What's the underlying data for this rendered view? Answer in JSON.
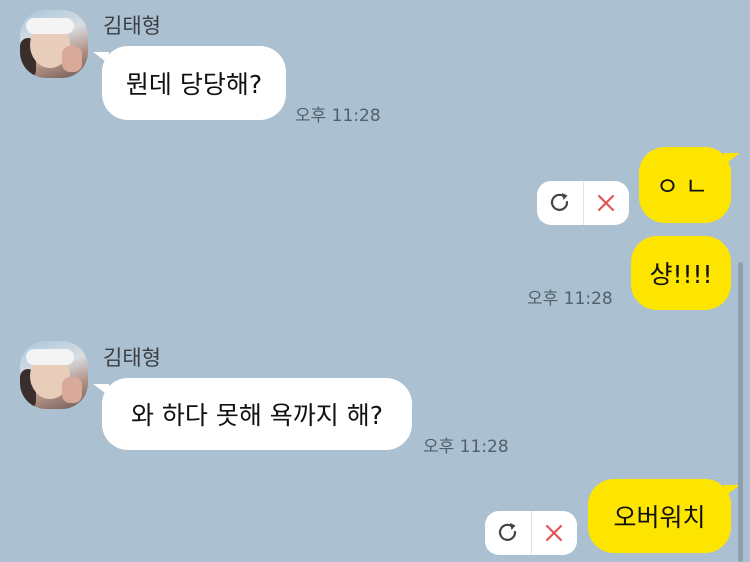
{
  "messages": {
    "m1": {
      "sender": "김태형",
      "text": "뭔데 당당해?",
      "time": "오후 11:28"
    },
    "m2": {
      "text": "ㅇㄴ"
    },
    "m3": {
      "text": "샹!!!!",
      "time": "오후 11:28"
    },
    "m4": {
      "sender": "김태형",
      "text": "와 하다 못해 욕까지 해?",
      "time": "오후 11:28"
    },
    "m5": {
      "text": "오버워치"
    }
  },
  "icons": {
    "resend": "refresh-icon",
    "delete": "close-icon"
  },
  "colors": {
    "background": "#abc1d1",
    "incoming": "#ffffff",
    "outgoing": "#fee500",
    "delete_icon": "#e25656"
  }
}
